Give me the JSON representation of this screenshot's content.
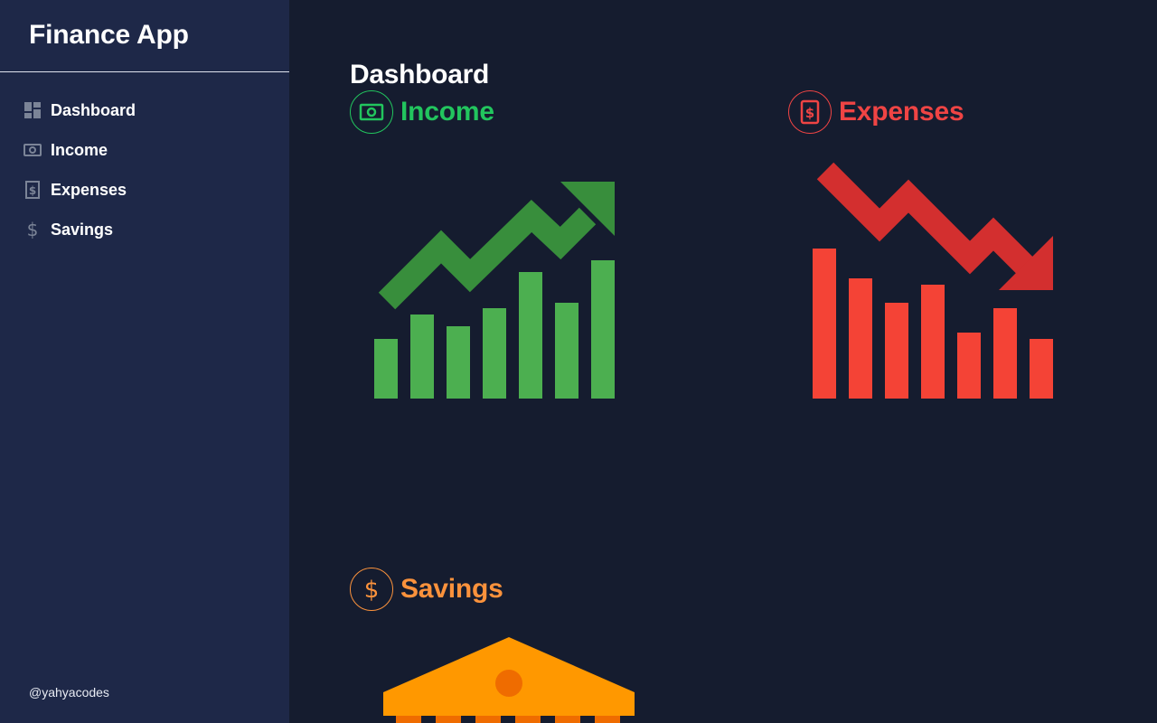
{
  "sidebar": {
    "brand": "Finance App",
    "items": [
      {
        "label": "Dashboard",
        "icon": "dashboard-icon"
      },
      {
        "label": "Income",
        "icon": "money-bill-icon"
      },
      {
        "label": "Expenses",
        "icon": "receipt-dollar-icon"
      },
      {
        "label": "Savings",
        "icon": "dollar-icon"
      }
    ],
    "credit": "@yahyacodes"
  },
  "main": {
    "title": "Dashboard",
    "cards": {
      "income": {
        "title": "Income",
        "color": "#22c55e",
        "icon": "money-bill-icon"
      },
      "expenses": {
        "title": "Expenses",
        "color": "#ef4444",
        "icon": "receipt-dollar-icon"
      },
      "savings": {
        "title": "Savings",
        "color": "#fb923c",
        "icon": "dollar-icon"
      }
    }
  },
  "colors": {
    "background": "#151c2f",
    "sidebar": "#1e2848",
    "income_bars": "#4caf50",
    "income_arrow": "#388e3c",
    "expense_bars": "#f44336",
    "expense_arrow": "#d32f2f",
    "savings_bank": "#ff9800"
  }
}
